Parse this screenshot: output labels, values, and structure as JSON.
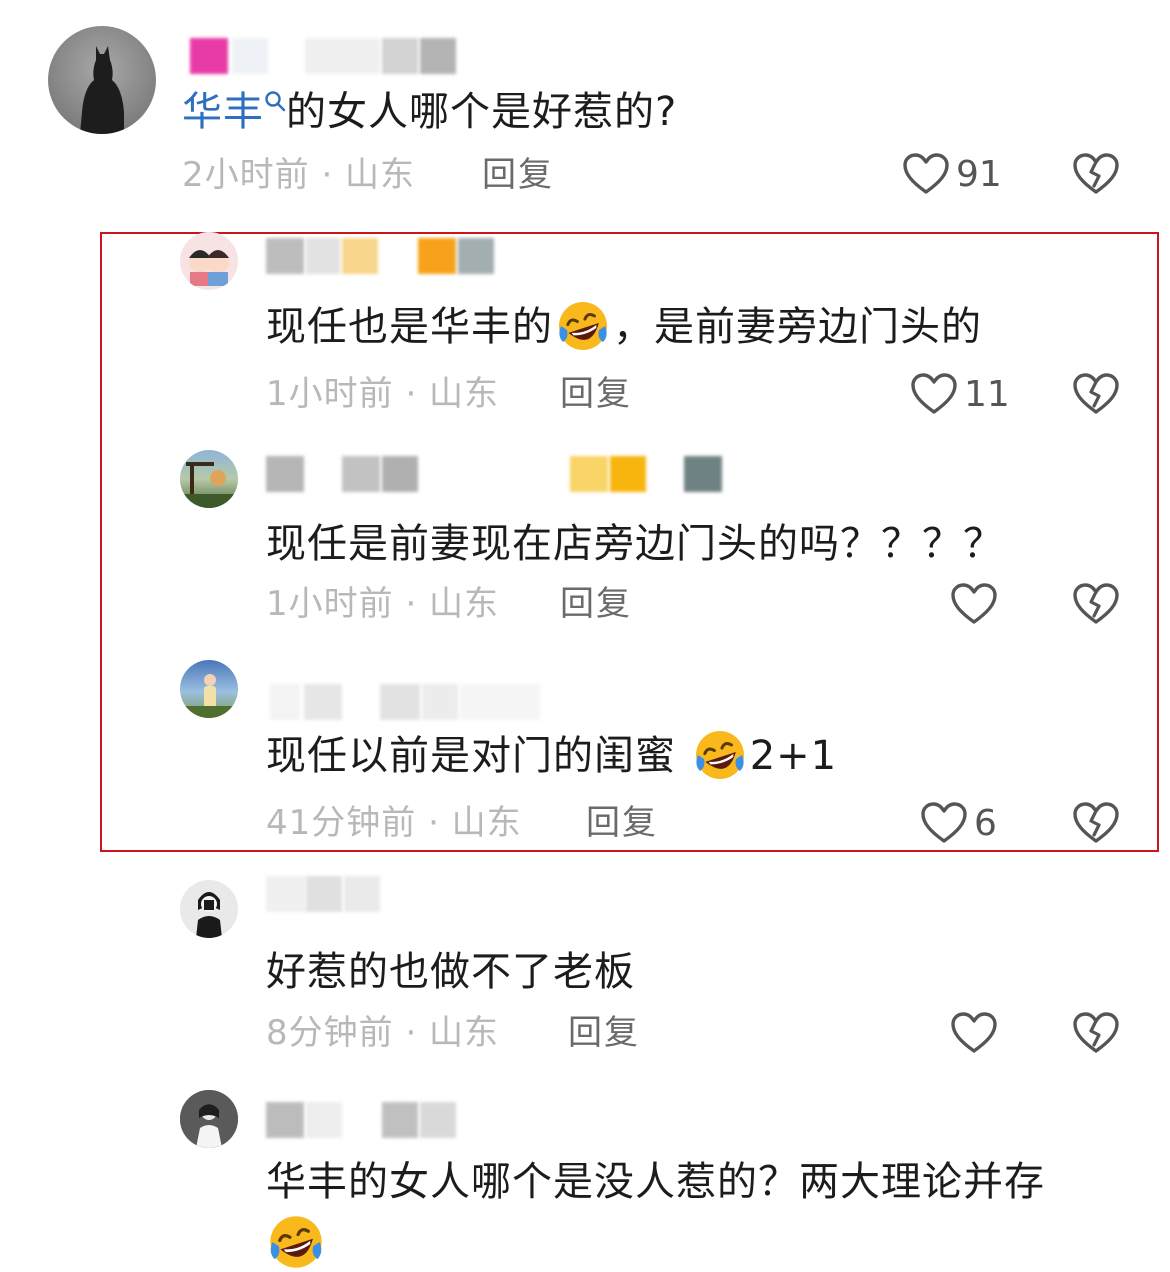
{
  "colors": {
    "highlight_border": "#c8161d",
    "link": "#2f6fbf",
    "meta": "#b8b8b8",
    "reply": "#6a6a6a"
  },
  "comments": [
    {
      "text_link": "华丰",
      "text_rest": "的女人哪个是好惹的?",
      "meta": "2小时前 · 山东",
      "reply": "回复",
      "likes": "91"
    },
    {
      "text": "现任也是华丰的",
      "text_after_emoji": "，是前妻旁边门头的",
      "meta": "1小时前 · 山东",
      "reply": "回复",
      "likes": "11"
    },
    {
      "text": "现任是前妻现在店旁边门头的吗？？？？",
      "meta": "1小时前 · 山东",
      "reply": "回复",
      "likes": ""
    },
    {
      "text": "现任以前是对门的闺蜜",
      "text_after_emoji": "2+1",
      "meta": "41分钟前 · 山东",
      "reply": "回复",
      "likes": "6"
    },
    {
      "text": "好惹的也做不了老板",
      "meta": "8分钟前 · 山东",
      "reply": "回复",
      "likes": ""
    },
    {
      "text": "华丰的女人哪个是没人惹的？两大理论并存"
    }
  ],
  "icons": {
    "like": "heart-outline-icon",
    "dislike": "broken-heart-icon",
    "search": "search-icon",
    "emoji": "laughing-crying-emoji-icon"
  }
}
